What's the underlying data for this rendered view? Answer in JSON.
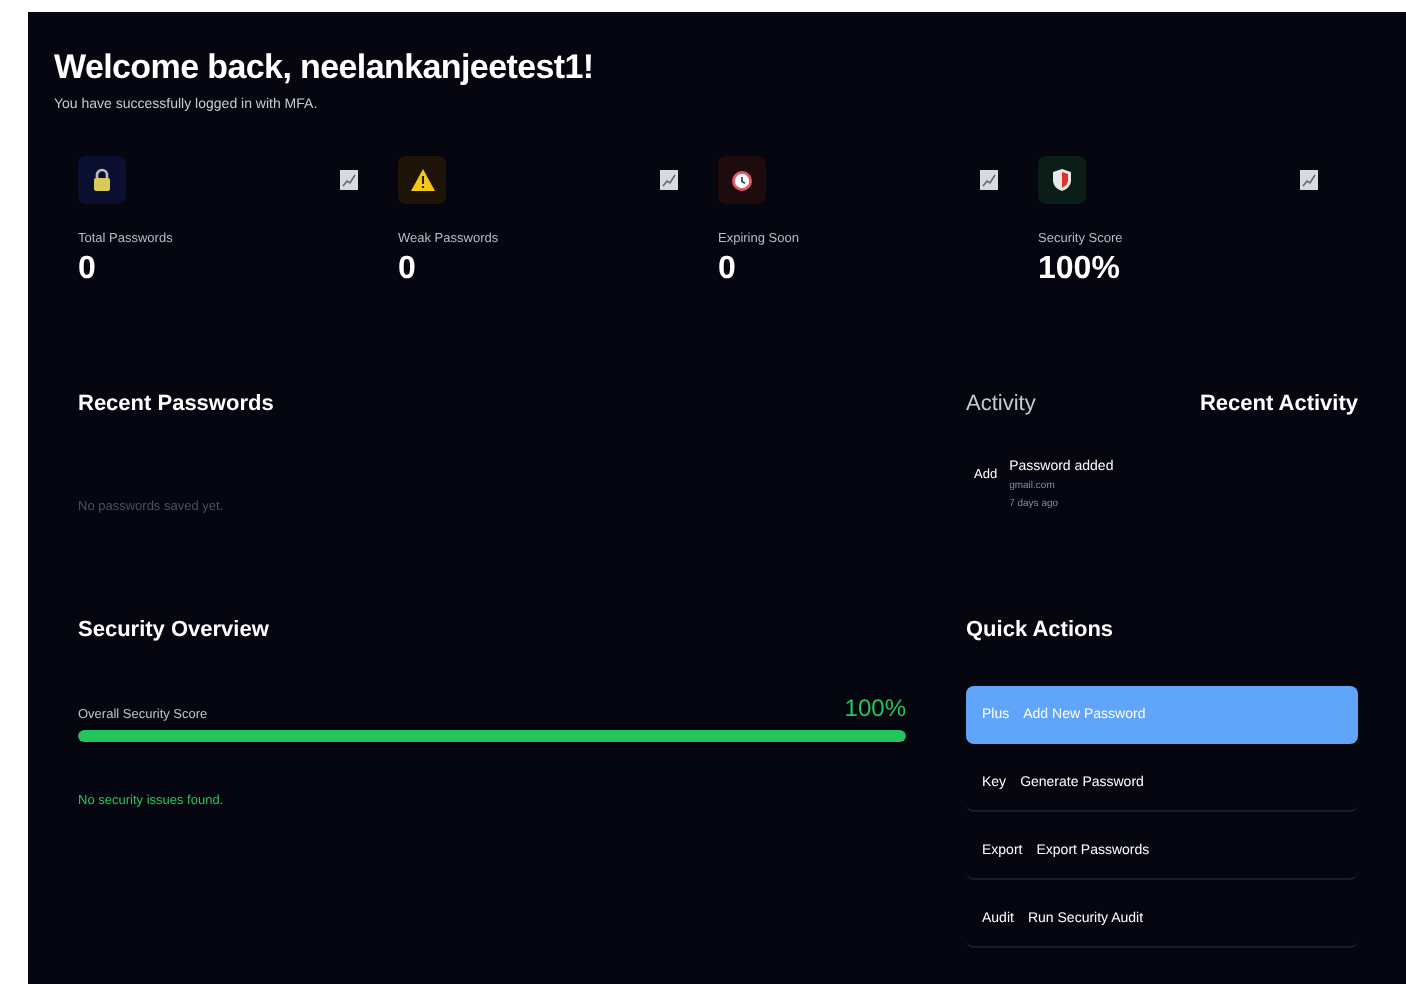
{
  "header": {
    "title": "Welcome back, neelankanjeetest1!",
    "subtitle": "You have successfully logged in with MFA."
  },
  "stats": [
    {
      "kind": "lock",
      "label": "Total Passwords",
      "value": "0"
    },
    {
      "kind": "warning",
      "label": "Weak Passwords",
      "value": "0"
    },
    {
      "kind": "clock",
      "label": "Expiring Soon",
      "value": "0"
    },
    {
      "kind": "shield",
      "label": "Security Score",
      "value": "100%"
    }
  ],
  "recent_passwords": {
    "title": "Recent Passwords",
    "empty_text": "No passwords saved yet."
  },
  "activity": {
    "tab_label": "Activity",
    "title": "Recent Activity",
    "items": [
      {
        "tag": "Add",
        "title": "Password added",
        "site": "gmail.com",
        "time": "7 days ago"
      }
    ]
  },
  "security_overview": {
    "title": "Security Overview",
    "score_label": "Overall Security Score",
    "score": "100%",
    "level": 1,
    "status": "No security issues found."
  },
  "quick_actions": {
    "title": "Quick Actions",
    "items": [
      {
        "icon_text": "Plus",
        "label": "Add New Password",
        "selected": true
      },
      {
        "icon_text": "Key",
        "label": "Generate Password",
        "selected": false
      },
      {
        "icon_text": "Export",
        "label": "Export Passwords",
        "selected": false
      },
      {
        "icon_text": "Audit",
        "label": "Run Security Audit",
        "selected": false
      }
    ]
  }
}
